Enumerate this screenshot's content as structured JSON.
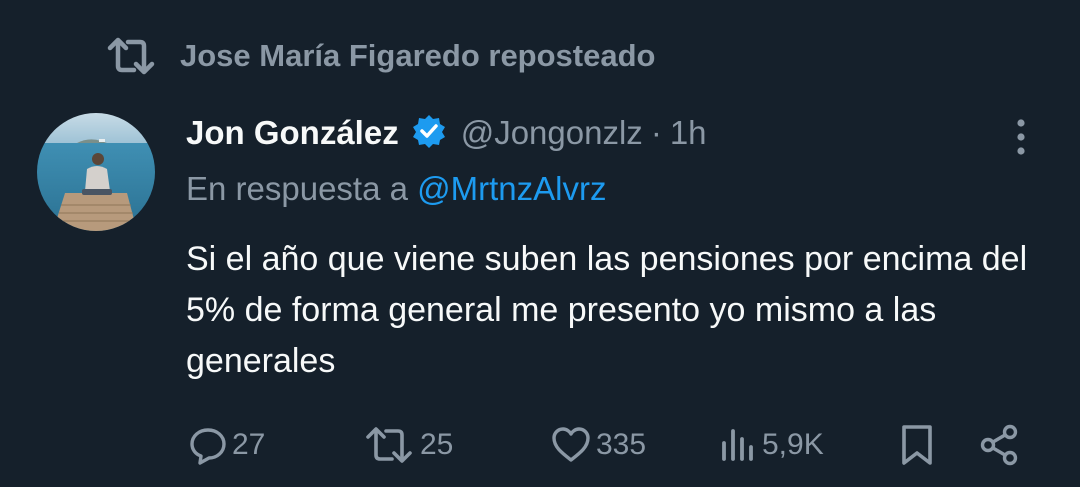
{
  "repost": {
    "icon": "repost-icon",
    "text": "Jose María Figaredo reposteado"
  },
  "tweet": {
    "author_name": "Jon González",
    "verified_icon": "verified-badge-icon",
    "handle": "@Jongonzlz",
    "separator": "·",
    "time": "1h",
    "reply_prefix": "En respuesta a",
    "reply_mention": "@MrtnzAlvrz",
    "text": "Si el año que viene suben las pensiones por encima del 5% de forma general me presento yo mismo a las generales"
  },
  "actions": {
    "replies": "27",
    "reposts": "25",
    "likes": "335",
    "views": "5,9K"
  },
  "colors": {
    "background": "#15202b",
    "text": "#f7f9f9",
    "muted": "#8b98a5",
    "accent": "#1d9bf0"
  }
}
